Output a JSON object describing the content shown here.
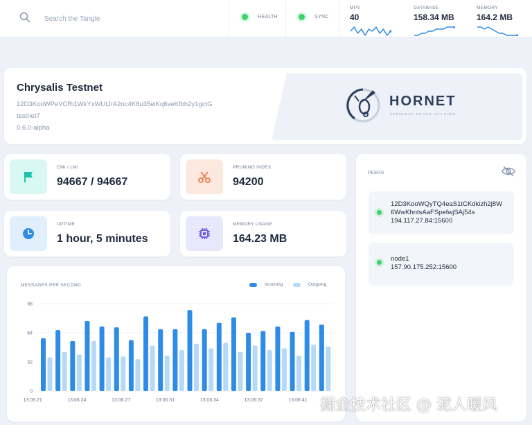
{
  "colors": {
    "accent": "#2f8ce6",
    "outgoing": "#b6d9f7",
    "health_ok": "#3ad36d",
    "background": "#eef2f8",
    "milestone_bg": "#d9f7f3",
    "milestone_icon": "#17c3ad",
    "pruning_bg": "#fde8df",
    "pruning_icon": "#ef7849",
    "uptime_bg": "#e1effc",
    "uptime_icon": "#2f8ce6",
    "memory_bg": "#e8e7fc",
    "memory_icon": "#6b5ce7"
  },
  "search": {
    "placeholder": "Search the Tangle",
    "icon": "search-icon"
  },
  "status": {
    "health_label": "HEALTH",
    "sync_label": "SYNC"
  },
  "metrics": {
    "mps": {
      "title": "MPS",
      "value": "40",
      "spark": [
        5,
        7,
        4,
        6,
        3,
        6,
        5,
        7,
        4,
        6,
        3,
        5
      ]
    },
    "database": {
      "title": "DATABASE",
      "value": "158.34 MB",
      "spark": [
        2,
        2,
        3,
        3,
        4,
        4,
        5,
        5,
        5,
        6,
        6,
        6
      ]
    },
    "memory": {
      "title": "MEMORY",
      "value": "164.2 MB",
      "spark": [
        6,
        6,
        5,
        6,
        5,
        4,
        3,
        3,
        2,
        2,
        2,
        2
      ]
    }
  },
  "node": {
    "name": "Chrysalis Testnet",
    "peer_id": "12D3KooWPeVCRi1WkYxWUtJrA2nc4K8u35eiKq6veKfbh2y1gctG",
    "network": "testnet7",
    "version": "0.6.0-alpha",
    "brand": "HORNET",
    "brand_tagline": "COMMUNITY DRIVEN IOTA NODE"
  },
  "info": {
    "milestone": {
      "title": "CMI / LMI",
      "value": "94667 / 94667",
      "icon": "flag-icon"
    },
    "pruning": {
      "title": "PRUNING INDEX",
      "value": "94200",
      "icon": "scissors-icon"
    },
    "uptime": {
      "title": "UPTIME",
      "value": "1 hour, 5 minutes",
      "icon": "clock-icon"
    },
    "memory": {
      "title": "MEMORY USAGE",
      "value": "164.23 MB",
      "icon": "chip-icon"
    }
  },
  "peers": {
    "title": "PEERS",
    "items": [
      {
        "line1": "12D3KooWQyTQ4eaS1tCKdkizh2j8W",
        "line2": "6WwKhntsAaFSpefwjSAj54s",
        "address": "194.117.27.84:15600"
      },
      {
        "line1": "node1",
        "address": "157.90.175.252:15600"
      }
    ]
  },
  "chart_data": {
    "type": "bar",
    "title": "MESSAGES PER SECOND",
    "xlabel": "",
    "ylabel": "",
    "ylim": [
      0,
      96
    ],
    "yticks": [
      0,
      32,
      64,
      96
    ],
    "x_tick_labels": [
      "13:06:21",
      "13:06:24",
      "13:06:27",
      "13:06:31",
      "13:06:34",
      "13:06:37",
      "13:06:41"
    ],
    "legend_placement": "top-right",
    "grid": true,
    "series": [
      {
        "name": "Incoming",
        "values": [
          58,
          67,
          55,
          77,
          71,
          70,
          56,
          82,
          68,
          68,
          89,
          68,
          75,
          81,
          64,
          66,
          71,
          65,
          78,
          73
        ]
      },
      {
        "name": "Outgoing",
        "values": [
          37,
          43,
          40,
          55,
          37,
          38,
          35,
          50,
          39,
          45,
          52,
          47,
          53,
          43,
          50,
          45,
          47,
          39,
          51,
          49
        ]
      }
    ]
  },
  "watermark": "掘金技术社区 @ 泥人暖风"
}
